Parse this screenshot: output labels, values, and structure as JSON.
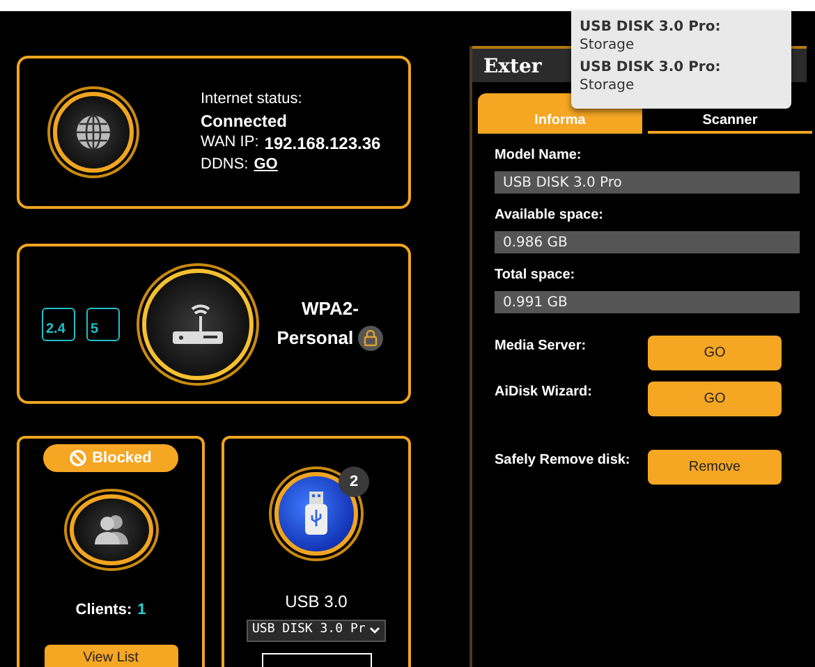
{
  "internet": {
    "status_label": "Internet status:",
    "status": "Connected",
    "wan_ip_label": "WAN IP:",
    "wan_ip": "192.168.123.36",
    "ddns_label": "DDNS:",
    "ddns_link": "GO"
  },
  "router": {
    "bands": [
      {
        "label": "2.4"
      },
      {
        "label": "5"
      }
    ],
    "security": "WPA2-Personal"
  },
  "clients": {
    "blocked_button": "Blocked",
    "label": "Clients:",
    "count": "1",
    "view_button": "View List"
  },
  "usb": {
    "badge": "2",
    "label": "USB 3.0",
    "device_select": "USB DISK 3.0 Pr"
  },
  "panel": {
    "title": "Exter",
    "tabs": [
      {
        "label": "Informa",
        "selected": true
      },
      {
        "label": "Scanner",
        "selected": false
      }
    ],
    "fields": [
      {
        "label": "Model Name:",
        "value": "USB DISK 3.0 Pro"
      },
      {
        "label": "Available space:",
        "value": "0.986 GB"
      },
      {
        "label": "Total space:",
        "value": "0.991 GB"
      }
    ],
    "actions": [
      {
        "label": "Media Server:",
        "button": "GO"
      },
      {
        "label": "AiDisk Wizard:",
        "button": "GO"
      },
      {
        "label": "Safely Remove disk:",
        "button": "Remove"
      }
    ]
  },
  "tooltip": {
    "entries": [
      {
        "name": "USB DISK 3.0 Pro:",
        "type": "Storage"
      },
      {
        "name": "USB DISK 3.0 Pro:",
        "type": "Storage"
      }
    ]
  }
}
